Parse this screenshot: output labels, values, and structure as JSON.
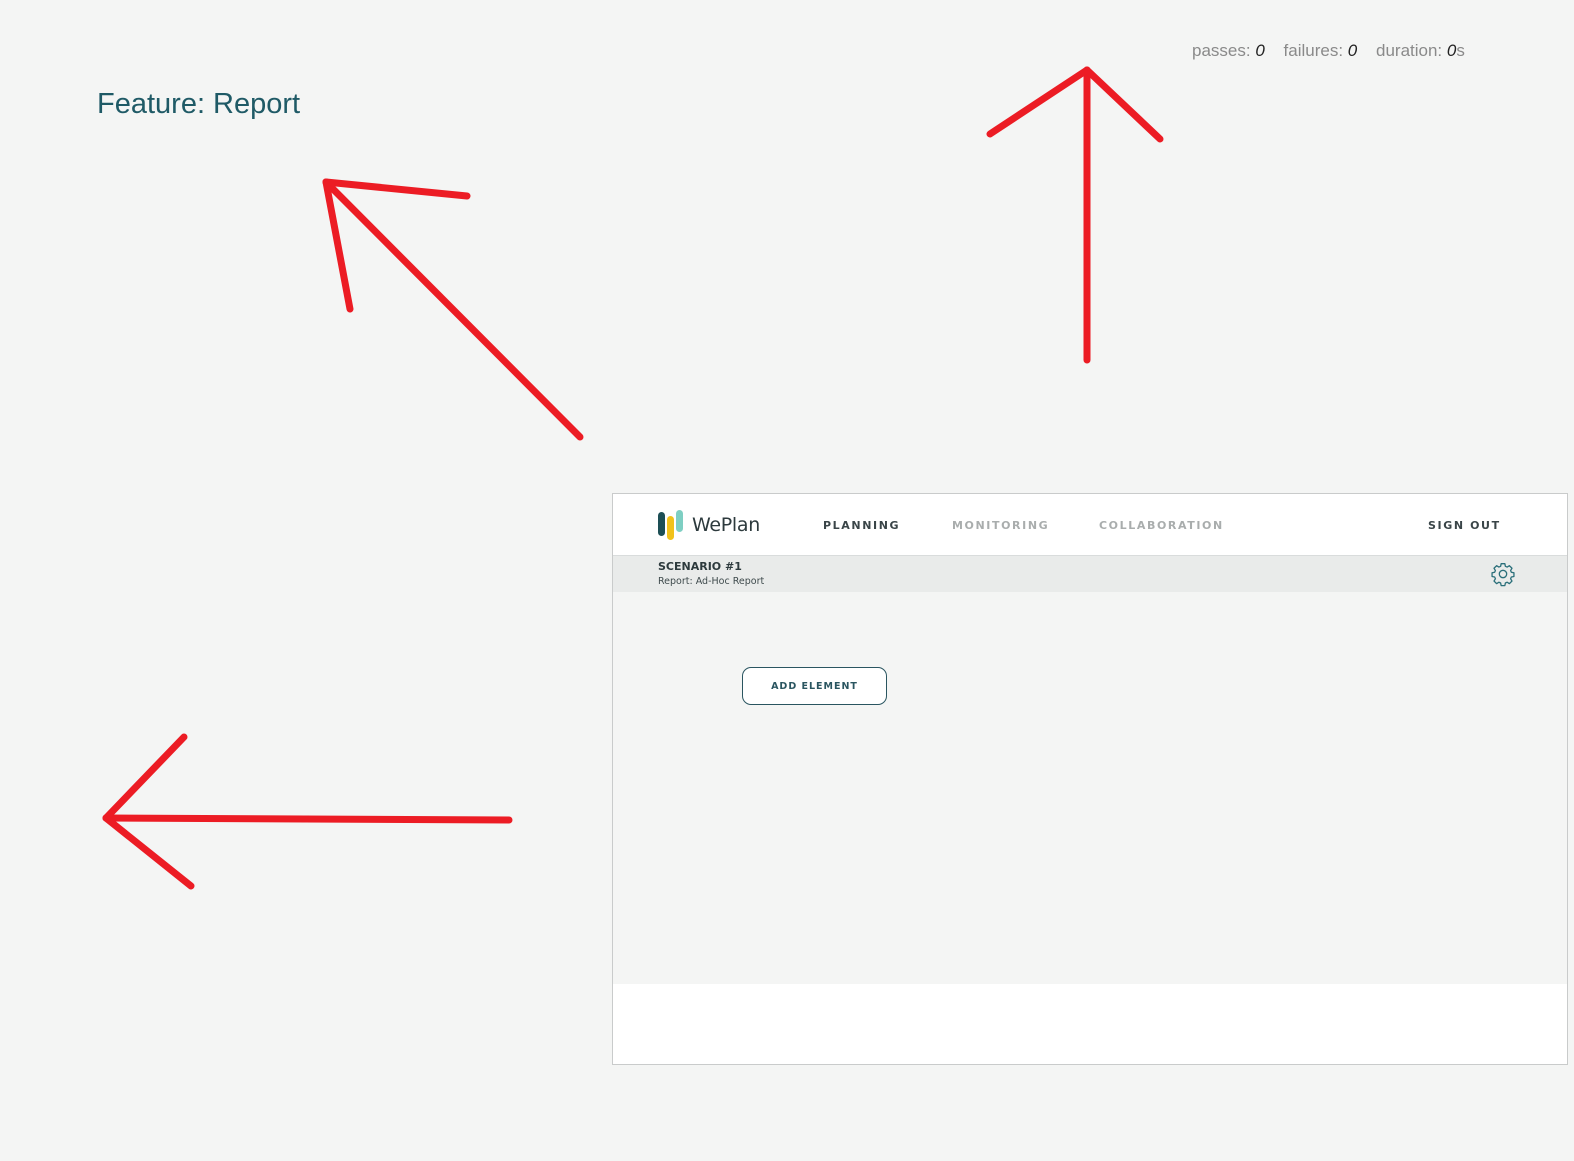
{
  "report": {
    "feature_title": "Feature: Report",
    "stats": {
      "passes_label": "passes:",
      "passes_value": "0",
      "failures_label": "failures:",
      "failures_value": "0",
      "duration_label": "duration:",
      "duration_value": "0",
      "duration_unit": "s"
    }
  },
  "annotations": {
    "arrow_color": "#ec1c24",
    "arrows": [
      "arrow-up-left",
      "arrow-up",
      "arrow-left"
    ]
  },
  "app": {
    "brand": "WePlan",
    "logo_colors": [
      "#1d4f55",
      "#f1c21b",
      "#7ecfc3"
    ],
    "nav": {
      "planning": "PLANNING",
      "monitoring": "MONITORING",
      "collaboration": "COLLABORATION",
      "sign_out": "SIGN OUT",
      "active": "PLANNING"
    },
    "subheader": {
      "scenario": "SCENARIO #1",
      "report": "Report: Ad-Hoc Report",
      "settings_icon": "gear-icon"
    },
    "content": {
      "add_element": "ADD ELEMENT"
    },
    "colors": {
      "accent": "#2a5560",
      "title": "#1f5a66"
    }
  }
}
